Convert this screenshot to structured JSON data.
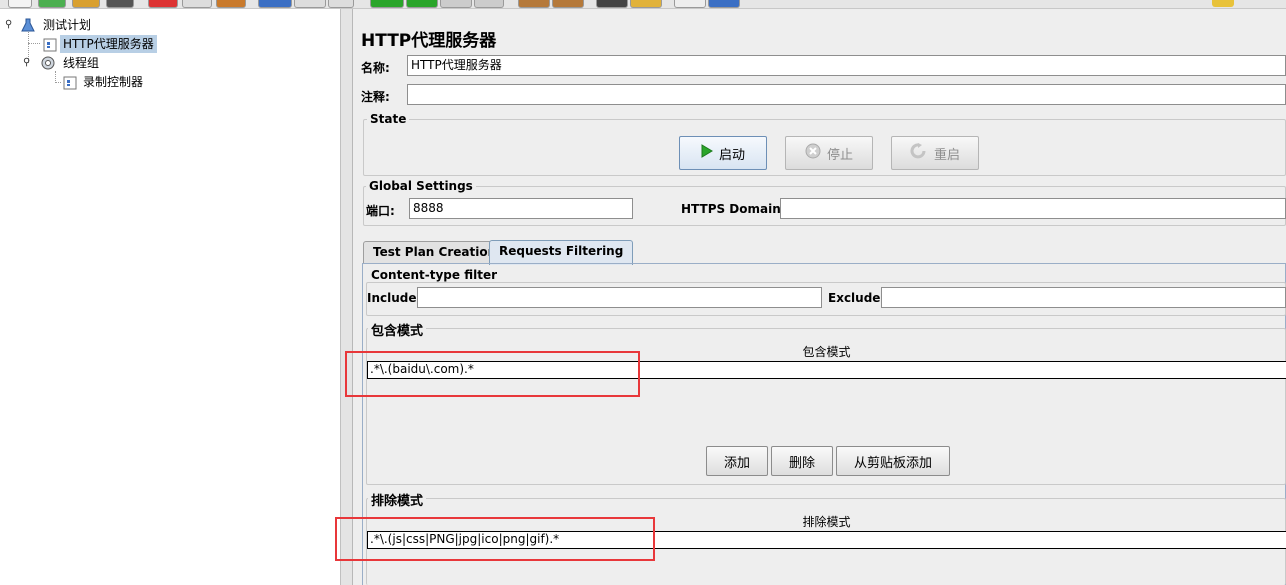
{
  "tree": {
    "nodes": [
      {
        "label": "测试计划"
      },
      {
        "label": "HTTP代理服务器"
      },
      {
        "label": "线程组"
      },
      {
        "label": "录制控制器"
      }
    ]
  },
  "main": {
    "title": "HTTP代理服务器",
    "name_label": "名称:",
    "name_value": "HTTP代理服务器",
    "comment_label": "注释:",
    "comment_value": "",
    "state": {
      "title": "State",
      "start_label": "启动",
      "stop_label": "停止",
      "restart_label": "重启"
    },
    "global": {
      "title": "Global Settings",
      "port_label": "端口:",
      "port_value": "8888",
      "https_label": "HTTPS Domains:",
      "https_value": ""
    },
    "tabs": [
      {
        "label": "Test Plan Creation"
      },
      {
        "label": "Requests Filtering"
      }
    ],
    "content_filter": {
      "title": "Content-type filter",
      "include_label": "Include:",
      "include_value": "",
      "exclude_label": "Exclude:",
      "exclude_value": ""
    },
    "include_patterns": {
      "title": "包含模式",
      "column": "包含模式",
      "rows": [
        ".*\\.(baidu\\.com).*"
      ]
    },
    "buttons": {
      "add": "添加",
      "delete": "删除",
      "add_clipboard": "从剪贴板添加"
    },
    "exclude_patterns": {
      "title": "排除模式",
      "column": "排除模式",
      "rows": [
        ".*\\.(js|css|PNG|jpg|ico|png|gif).*"
      ]
    }
  },
  "colors": {
    "highlight": "#e8373a",
    "selection": "#b8cfe5",
    "start_icon": "#2aa52a"
  }
}
